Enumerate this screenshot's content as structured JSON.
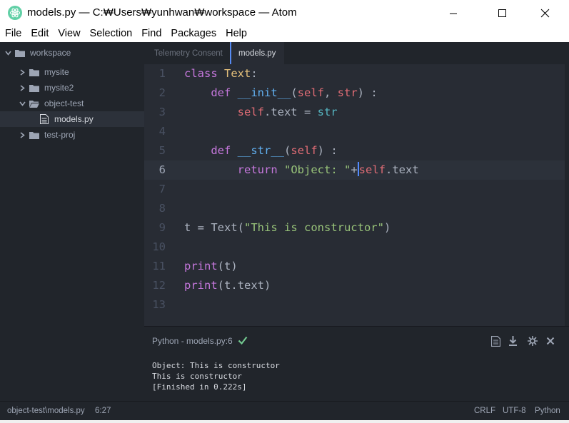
{
  "window": {
    "title": "models.py — C:₩Users₩yunhwan₩workspace — Atom",
    "icon": "atom-logo-icon",
    "accent": "#61d0a6"
  },
  "menu": [
    "File",
    "Edit",
    "View",
    "Selection",
    "Find",
    "Packages",
    "Help"
  ],
  "tree": {
    "root": "workspace",
    "items": [
      {
        "label": "mysite",
        "type": "folder",
        "expanded": false
      },
      {
        "label": "mysite2",
        "type": "folder",
        "expanded": false
      },
      {
        "label": "object-test",
        "type": "folder",
        "expanded": true
      },
      {
        "label": "models.py",
        "type": "file",
        "selected": true
      },
      {
        "label": "test-proj",
        "type": "folder",
        "expanded": false
      }
    ]
  },
  "tabs": [
    {
      "label": "Telemetry Consent",
      "active": false
    },
    {
      "label": "models.py",
      "active": true
    }
  ],
  "editor": {
    "line_numbers": [
      "1",
      "2",
      "3",
      "4",
      "5",
      "6",
      "7",
      "8",
      "9",
      "10",
      "11",
      "12",
      "13"
    ],
    "current_line": 6,
    "lines": [
      [
        [
          "kw",
          "class"
        ],
        [
          "",
          " "
        ],
        [
          "cls",
          "Text"
        ],
        [
          "",
          ":"
        ]
      ],
      [
        [
          "",
          "    "
        ],
        [
          "kw",
          "def"
        ],
        [
          "",
          " "
        ],
        [
          "fn",
          "__init__"
        ],
        [
          "",
          "("
        ],
        [
          "sf",
          "self"
        ],
        [
          "",
          ", "
        ],
        [
          "sf",
          "str"
        ],
        [
          "",
          ") :"
        ]
      ],
      [
        [
          "",
          "        "
        ],
        [
          "sf",
          "self"
        ],
        [
          "",
          ".text = "
        ],
        [
          "bi",
          "str"
        ]
      ],
      [],
      [
        [
          "",
          "    "
        ],
        [
          "kw",
          "def"
        ],
        [
          "",
          " "
        ],
        [
          "fn",
          "__str__"
        ],
        [
          "",
          "("
        ],
        [
          "sf",
          "self"
        ],
        [
          "",
          ") :"
        ]
      ],
      [
        [
          "",
          "        "
        ],
        [
          "kw",
          "return"
        ],
        [
          "",
          " "
        ],
        [
          "str",
          "\"Object: \""
        ],
        [
          "",
          "+"
        ],
        [
          "sf",
          "self"
        ],
        [
          "",
          ".text"
        ]
      ],
      [],
      [],
      [
        [
          "",
          "t = Text("
        ],
        [
          "str",
          "\"This is constructor\""
        ],
        [
          "",
          ")"
        ]
      ],
      [],
      [
        [
          "kw",
          "print"
        ],
        [
          "",
          "(t)"
        ]
      ],
      [
        [
          "kw",
          "print"
        ],
        [
          "",
          "(t.text)"
        ]
      ],
      []
    ],
    "cursor_after": "\"Object: \"+"
  },
  "script_panel": {
    "title": "Python - models.py:6",
    "status_icon": "check-icon",
    "status_color": "#73c990",
    "actions": [
      "copy-output-icon",
      "download-icon",
      "settings-pin-icon",
      "close-icon"
    ],
    "output": [
      "Object: This is constructor",
      "This is constructor",
      "[Finished in 0.222s]"
    ]
  },
  "statusbar": {
    "file_path": "object-test\\models.py",
    "cursor_position": "6:27",
    "line_ending": "CRLF",
    "encoding": "UTF-8",
    "grammar": "Python"
  }
}
